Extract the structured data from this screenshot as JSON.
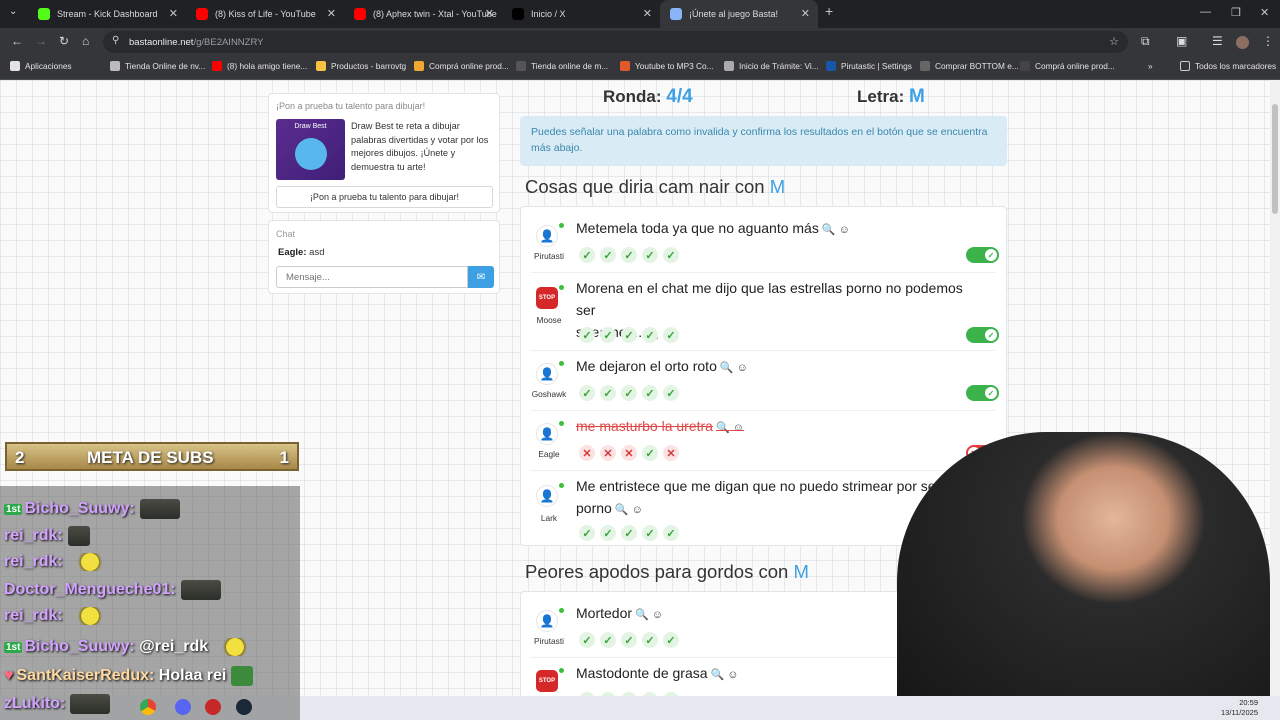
{
  "browser": {
    "tabs": [
      {
        "title": "Stream - Kick Dashboard",
        "icon": "kick-icon",
        "color": "#53fc18"
      },
      {
        "title": "(8) Kiss of Life - YouTube",
        "icon": "youtube-icon",
        "color": "#ff0000"
      },
      {
        "title": "(8) Aphex twin - Xtal - YouTube",
        "icon": "youtube-icon",
        "color": "#ff0000"
      },
      {
        "title": "Inicio / X",
        "icon": "x-icon",
        "color": "#000000"
      },
      {
        "title": "¡Únete al juego Basta!",
        "icon": "globe-icon",
        "color": "#8ab4f8"
      }
    ],
    "url_host": "bastaonline.net",
    "url_path": "/g/BE2AINNZRY",
    "bookmarks": [
      "Aplicaciones",
      "Tienda Online de nv...",
      "(8) hola amigo tiene...",
      "Productos - barrovtg",
      "Comprá online prod...",
      "Tienda online de m...",
      "Youtube to MP3 Co...",
      "Inicio de Trámite: Vi...",
      "Pirutastic | Settings",
      "Comprar BOTTOM e...",
      "Comprá online prod..."
    ],
    "bookmarks_all": "Todos los marcadores"
  },
  "ad": {
    "header": "¡Pon a prueba tu talento para dibujar!",
    "image_text": "Draw Best",
    "body": "Draw Best te reta a dibujar palabras divertidas y votar por los mejores dibujos. ¡Únete y demuestra tu arte!",
    "button": "¡Pon a prueba tu talento para dibujar!"
  },
  "chat": {
    "title": "Chat",
    "user": "Eagle:",
    "message": "asd",
    "placeholder": "Mensaje..."
  },
  "game": {
    "round_label": "Ronda:",
    "round_value": "4/4",
    "letter_label": "Letra:",
    "letter_value": "M",
    "info": "Puedes señalar una palabra como invalida y confirma los resultados en el botón que se encuentra más abajo."
  },
  "categories": [
    {
      "title": "Cosas que diria cam nair con",
      "letter": "M",
      "answers": [
        {
          "player": "Pirutasti",
          "avatar": "user",
          "line1": "Metemela toda ya que no aguanto más",
          "line2": "",
          "valid": true,
          "votes": [
            "ok",
            "ok",
            "ok",
            "ok",
            "ok"
          ]
        },
        {
          "player": "Moose",
          "avatar": "stop",
          "line1": "Morena en el chat me dijo que las estrellas porno no podemos ser",
          "line2": "streamer...",
          "valid": true,
          "votes": [
            "ok",
            "ok",
            "ok",
            "ok",
            "ok"
          ]
        },
        {
          "player": "Goshawk",
          "avatar": "user",
          "line1": "Me dejaron el orto roto",
          "line2": "",
          "valid": true,
          "votes": [
            "ok",
            "ok",
            "ok",
            "ok",
            "ok"
          ]
        },
        {
          "player": "Eagle",
          "avatar": "user",
          "line1": "me masturbo la uretra",
          "line2": "",
          "valid": false,
          "votes": [
            "no",
            "no",
            "no",
            "ok",
            "no"
          ]
        },
        {
          "player": "Lark",
          "avatar": "user",
          "line1": "Me entristece que me digan que no puedo strimear por ser actriz",
          "line2": "porno",
          "valid": true,
          "votes": [
            "ok",
            "ok",
            "ok",
            "ok",
            "ok"
          ]
        }
      ]
    },
    {
      "title": "Peores apodos para gordos con",
      "letter": "M",
      "answers": [
        {
          "player": "Pirutasti",
          "avatar": "user",
          "line1": "Mortedor",
          "line2": "",
          "valid": true,
          "votes": [
            "ok",
            "ok",
            "ok",
            "ok",
            "ok"
          ]
        },
        {
          "player": "Moose",
          "avatar": "stop",
          "line1": "Mastodonte de grasa",
          "line2": "",
          "valid": true,
          "votes": [
            "ok",
            "ok",
            "ok",
            "ok",
            "ok"
          ]
        }
      ]
    }
  ],
  "overlay": {
    "meta_left": "2",
    "meta_title": "META DE SUBS",
    "meta_right": "1",
    "messages": [
      {
        "user": "Bicho_Suuwy:",
        "text": "",
        "badge": "1st",
        "emotes": [
          "dark"
        ]
      },
      {
        "user": "rei_rdk:",
        "text": "",
        "badge": "",
        "emotes": [
          "dark-sm"
        ]
      },
      {
        "user": "rei_rdk:",
        "text": "",
        "badge": "",
        "emotes": [
          "yellow"
        ]
      },
      {
        "user": "Doctor_Mengueche01:",
        "text": "",
        "badge": "",
        "emotes": [
          "dark"
        ]
      },
      {
        "user": "rei_rdk:",
        "text": "",
        "badge": "",
        "emotes": [
          "yellow"
        ]
      },
      {
        "user": "Bicho_Suuwy:",
        "text": "@rei_rdk",
        "badge": "1st",
        "emotes": [
          "yellow"
        ]
      },
      {
        "user": "SantKaiserRedux:",
        "text": "Holaa rei",
        "badge": "heart",
        "emotes": [
          "green"
        ]
      },
      {
        "user": "zLukito:",
        "text": "",
        "badge": "",
        "emotes": [
          "dark"
        ]
      }
    ]
  },
  "taskbar": {
    "time": "20:59",
    "date": "13/11/2025"
  }
}
